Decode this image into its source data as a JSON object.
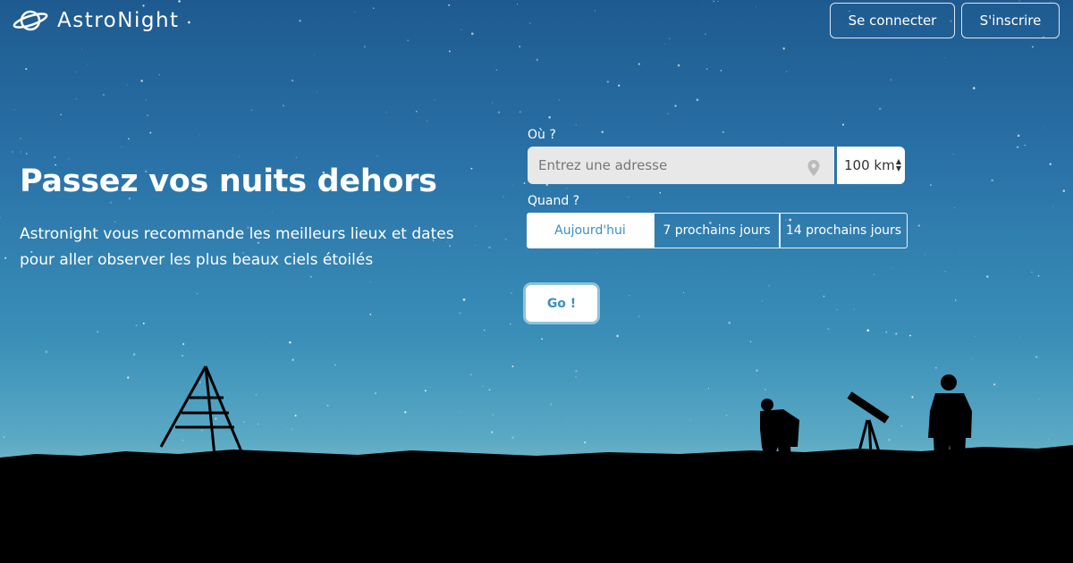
{
  "brand": {
    "name": "AstroNight",
    "logo_icon": "planet-icon"
  },
  "header": {
    "login_label": "Se connecter",
    "signup_label": "S'inscrire"
  },
  "hero": {
    "title": "Passez vos nuits dehors",
    "subtitle_line1": "Astronight vous recommande les meilleurs lieux et dates",
    "subtitle_line2": "pour aller observer les plus beaux ciels étoilés"
  },
  "search": {
    "where_label": "Où ?",
    "address_placeholder": "Entrez une adresse",
    "address_icon": "map-pin-icon",
    "radius_value": "100 km",
    "when_label": "Quand ?",
    "periods": [
      "Aujourd'hui",
      "7 prochains jours",
      "14 prochains jours"
    ],
    "selected_period": "Aujourd'hui",
    "submit_label": "Go !"
  },
  "colors": {
    "accent": "#3b8fc1",
    "sky": "#2a73a8",
    "ground": "#000000"
  }
}
